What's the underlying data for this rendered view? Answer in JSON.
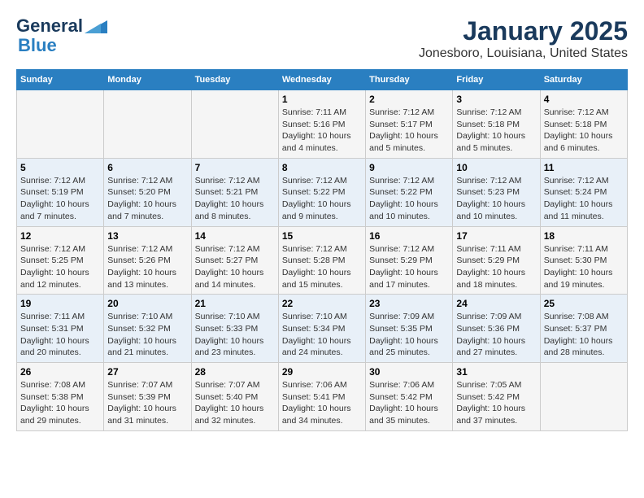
{
  "header": {
    "logo_line1": "General",
    "logo_line2": "Blue",
    "title": "January 2025",
    "subtitle": "Jonesboro, Louisiana, United States"
  },
  "days_of_week": [
    "Sunday",
    "Monday",
    "Tuesday",
    "Wednesday",
    "Thursday",
    "Friday",
    "Saturday"
  ],
  "weeks": [
    [
      {
        "day": "",
        "info": ""
      },
      {
        "day": "",
        "info": ""
      },
      {
        "day": "",
        "info": ""
      },
      {
        "day": "1",
        "info": "Sunrise: 7:11 AM\nSunset: 5:16 PM\nDaylight: 10 hours\nand 4 minutes."
      },
      {
        "day": "2",
        "info": "Sunrise: 7:12 AM\nSunset: 5:17 PM\nDaylight: 10 hours\nand 5 minutes."
      },
      {
        "day": "3",
        "info": "Sunrise: 7:12 AM\nSunset: 5:18 PM\nDaylight: 10 hours\nand 5 minutes."
      },
      {
        "day": "4",
        "info": "Sunrise: 7:12 AM\nSunset: 5:18 PM\nDaylight: 10 hours\nand 6 minutes."
      }
    ],
    [
      {
        "day": "5",
        "info": "Sunrise: 7:12 AM\nSunset: 5:19 PM\nDaylight: 10 hours\nand 7 minutes."
      },
      {
        "day": "6",
        "info": "Sunrise: 7:12 AM\nSunset: 5:20 PM\nDaylight: 10 hours\nand 7 minutes."
      },
      {
        "day": "7",
        "info": "Sunrise: 7:12 AM\nSunset: 5:21 PM\nDaylight: 10 hours\nand 8 minutes."
      },
      {
        "day": "8",
        "info": "Sunrise: 7:12 AM\nSunset: 5:22 PM\nDaylight: 10 hours\nand 9 minutes."
      },
      {
        "day": "9",
        "info": "Sunrise: 7:12 AM\nSunset: 5:22 PM\nDaylight: 10 hours\nand 10 minutes."
      },
      {
        "day": "10",
        "info": "Sunrise: 7:12 AM\nSunset: 5:23 PM\nDaylight: 10 hours\nand 10 minutes."
      },
      {
        "day": "11",
        "info": "Sunrise: 7:12 AM\nSunset: 5:24 PM\nDaylight: 10 hours\nand 11 minutes."
      }
    ],
    [
      {
        "day": "12",
        "info": "Sunrise: 7:12 AM\nSunset: 5:25 PM\nDaylight: 10 hours\nand 12 minutes."
      },
      {
        "day": "13",
        "info": "Sunrise: 7:12 AM\nSunset: 5:26 PM\nDaylight: 10 hours\nand 13 minutes."
      },
      {
        "day": "14",
        "info": "Sunrise: 7:12 AM\nSunset: 5:27 PM\nDaylight: 10 hours\nand 14 minutes."
      },
      {
        "day": "15",
        "info": "Sunrise: 7:12 AM\nSunset: 5:28 PM\nDaylight: 10 hours\nand 15 minutes."
      },
      {
        "day": "16",
        "info": "Sunrise: 7:12 AM\nSunset: 5:29 PM\nDaylight: 10 hours\nand 17 minutes."
      },
      {
        "day": "17",
        "info": "Sunrise: 7:11 AM\nSunset: 5:29 PM\nDaylight: 10 hours\nand 18 minutes."
      },
      {
        "day": "18",
        "info": "Sunrise: 7:11 AM\nSunset: 5:30 PM\nDaylight: 10 hours\nand 19 minutes."
      }
    ],
    [
      {
        "day": "19",
        "info": "Sunrise: 7:11 AM\nSunset: 5:31 PM\nDaylight: 10 hours\nand 20 minutes."
      },
      {
        "day": "20",
        "info": "Sunrise: 7:10 AM\nSunset: 5:32 PM\nDaylight: 10 hours\nand 21 minutes."
      },
      {
        "day": "21",
        "info": "Sunrise: 7:10 AM\nSunset: 5:33 PM\nDaylight: 10 hours\nand 23 minutes."
      },
      {
        "day": "22",
        "info": "Sunrise: 7:10 AM\nSunset: 5:34 PM\nDaylight: 10 hours\nand 24 minutes."
      },
      {
        "day": "23",
        "info": "Sunrise: 7:09 AM\nSunset: 5:35 PM\nDaylight: 10 hours\nand 25 minutes."
      },
      {
        "day": "24",
        "info": "Sunrise: 7:09 AM\nSunset: 5:36 PM\nDaylight: 10 hours\nand 27 minutes."
      },
      {
        "day": "25",
        "info": "Sunrise: 7:08 AM\nSunset: 5:37 PM\nDaylight: 10 hours\nand 28 minutes."
      }
    ],
    [
      {
        "day": "26",
        "info": "Sunrise: 7:08 AM\nSunset: 5:38 PM\nDaylight: 10 hours\nand 29 minutes."
      },
      {
        "day": "27",
        "info": "Sunrise: 7:07 AM\nSunset: 5:39 PM\nDaylight: 10 hours\nand 31 minutes."
      },
      {
        "day": "28",
        "info": "Sunrise: 7:07 AM\nSunset: 5:40 PM\nDaylight: 10 hours\nand 32 minutes."
      },
      {
        "day": "29",
        "info": "Sunrise: 7:06 AM\nSunset: 5:41 PM\nDaylight: 10 hours\nand 34 minutes."
      },
      {
        "day": "30",
        "info": "Sunrise: 7:06 AM\nSunset: 5:42 PM\nDaylight: 10 hours\nand 35 minutes."
      },
      {
        "day": "31",
        "info": "Sunrise: 7:05 AM\nSunset: 5:42 PM\nDaylight: 10 hours\nand 37 minutes."
      },
      {
        "day": "",
        "info": ""
      }
    ]
  ]
}
